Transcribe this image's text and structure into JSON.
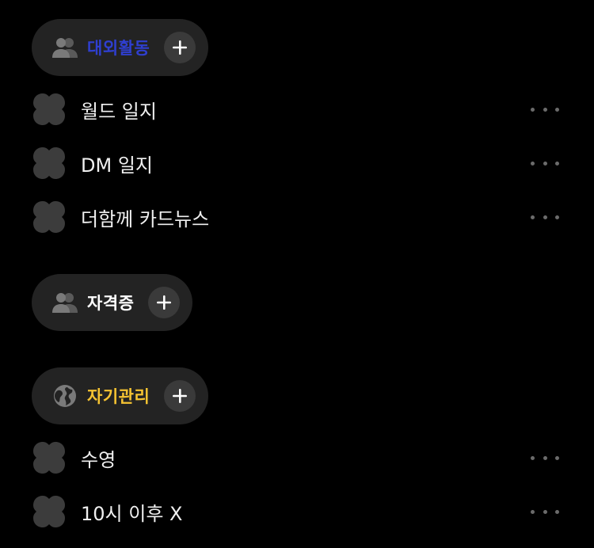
{
  "colors": {
    "background": "#000000",
    "chip_background": "#232323",
    "add_button_background": "#3a3a3a",
    "icon_gray": "#6e6e6e",
    "row_icon": "#3c3c3c",
    "more_dots": "#6b6b6b"
  },
  "sections": [
    {
      "title": "대외활동",
      "title_color": "#2f3fd0",
      "icon": "people-icon",
      "items": [
        {
          "label": "월드 일지"
        },
        {
          "label": "DM 일지"
        },
        {
          "label": "더함께 카드뉴스"
        }
      ]
    },
    {
      "title": "자격증",
      "title_color": "#ffffff",
      "icon": "people-icon",
      "items": []
    },
    {
      "title": "자기관리",
      "title_color": "#f5c332",
      "icon": "globe-icon",
      "items": [
        {
          "label": "수영"
        },
        {
          "label": "10시 이후 X"
        }
      ]
    }
  ]
}
